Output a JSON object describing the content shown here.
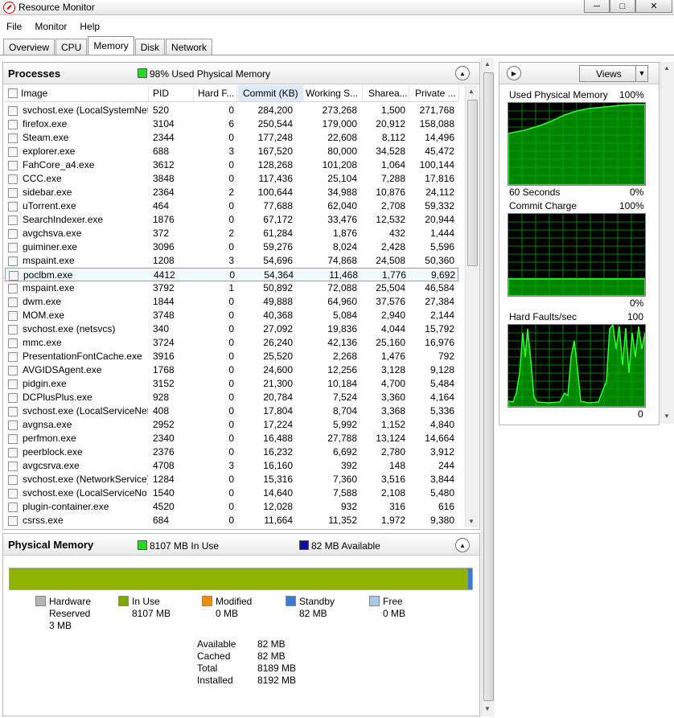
{
  "window": {
    "title": "Resource Monitor"
  },
  "menu": [
    "File",
    "Monitor",
    "Help"
  ],
  "tabs": [
    "Overview",
    "CPU",
    "Memory",
    "Disk",
    "Network"
  ],
  "active_tab": "Memory",
  "processes": {
    "title": "Processes",
    "status": "98% Used Physical Memory",
    "status_color": "#22dd22",
    "columns": [
      "Image",
      "PID",
      "Hard F...",
      "Commit (KB)",
      "Working S...",
      "Sharea...",
      "Private ..."
    ],
    "rows": [
      [
        "svchost.exe (LocalSystemNet...",
        "520",
        "0",
        "284,200",
        "273,268",
        "1,500",
        "271,768"
      ],
      [
        "firefox.exe",
        "3104",
        "6",
        "250,544",
        "179,000",
        "20,912",
        "158,088"
      ],
      [
        "Steam.exe",
        "2344",
        "0",
        "177,248",
        "22,608",
        "8,112",
        "14,496"
      ],
      [
        "explorer.exe",
        "688",
        "3",
        "167,520",
        "80,000",
        "34,528",
        "45,472"
      ],
      [
        "FahCore_a4.exe",
        "3612",
        "0",
        "128,268",
        "101,208",
        "1,064",
        "100,144"
      ],
      [
        "CCC.exe",
        "3848",
        "0",
        "117,436",
        "25,104",
        "7,288",
        "17,816"
      ],
      [
        "sidebar.exe",
        "2364",
        "2",
        "100,644",
        "34,988",
        "10,876",
        "24,112"
      ],
      [
        "uTorrent.exe",
        "464",
        "0",
        "77,688",
        "62,040",
        "2,708",
        "59,332"
      ],
      [
        "SearchIndexer.exe",
        "1876",
        "0",
        "67,172",
        "33,476",
        "12,532",
        "20,944"
      ],
      [
        "avgchsva.exe",
        "372",
        "2",
        "61,284",
        "1,876",
        "432",
        "1,444"
      ],
      [
        "guiminer.exe",
        "3096",
        "0",
        "59,276",
        "8,024",
        "2,428",
        "5,596"
      ],
      [
        "mspaint.exe",
        "1208",
        "3",
        "54,696",
        "74,868",
        "24,508",
        "50,360"
      ],
      [
        "poclbm.exe",
        "4412",
        "0",
        "54,364",
        "11,468",
        "1,776",
        "9,692"
      ],
      [
        "mspaint.exe",
        "3792",
        "1",
        "50,892",
        "72,088",
        "25,504",
        "46,584"
      ],
      [
        "dwm.exe",
        "1844",
        "0",
        "49,888",
        "64,960",
        "37,576",
        "27,384"
      ],
      [
        "MOM.exe",
        "3748",
        "0",
        "40,368",
        "5,084",
        "2,940",
        "2,144"
      ],
      [
        "svchost.exe (netsvcs)",
        "340",
        "0",
        "27,092",
        "19,836",
        "4,044",
        "15,792"
      ],
      [
        "mmc.exe",
        "3724",
        "0",
        "26,240",
        "42,136",
        "25,160",
        "16,976"
      ],
      [
        "PresentationFontCache.exe",
        "3916",
        "0",
        "25,520",
        "2,268",
        "1,476",
        "792"
      ],
      [
        "AVGIDSAgent.exe",
        "1768",
        "0",
        "24,600",
        "12,256",
        "3,128",
        "9,128"
      ],
      [
        "pidgin.exe",
        "3152",
        "0",
        "21,300",
        "10,184",
        "4,700",
        "5,484"
      ],
      [
        "DCPlusPlus.exe",
        "928",
        "0",
        "20,784",
        "7,524",
        "3,360",
        "4,164"
      ],
      [
        "svchost.exe (LocalServiceNet...",
        "408",
        "0",
        "17,804",
        "8,704",
        "3,368",
        "5,336"
      ],
      [
        "avgnsa.exe",
        "2952",
        "0",
        "17,224",
        "5,992",
        "1,152",
        "4,840"
      ],
      [
        "perfmon.exe",
        "2340",
        "0",
        "16,488",
        "27,788",
        "13,124",
        "14,664"
      ],
      [
        "peerblock.exe",
        "2376",
        "0",
        "16,232",
        "6,692",
        "2,780",
        "3,912"
      ],
      [
        "avgcsrva.exe",
        "4708",
        "3",
        "16,160",
        "392",
        "148",
        "244"
      ],
      [
        "svchost.exe (NetworkService)",
        "1284",
        "0",
        "15,316",
        "7,360",
        "3,516",
        "3,844"
      ],
      [
        "svchost.exe (LocalServiceNo...",
        "1540",
        "0",
        "14,640",
        "7,588",
        "2,108",
        "5,480"
      ],
      [
        "plugin-container.exe",
        "4520",
        "0",
        "12,028",
        "932",
        "316",
        "616"
      ],
      [
        "csrss.exe",
        "684",
        "0",
        "11,664",
        "11,352",
        "1,972",
        "9,380"
      ]
    ]
  },
  "physical_memory": {
    "title": "Physical Memory",
    "in_use_label": "8107 MB In Use",
    "available_label": "82 MB Available",
    "in_use_color": "#22dd22",
    "available_color": "#1010a0",
    "usage_fraction": 0.99,
    "legend": [
      {
        "label": "Hardware",
        "label2": "Reserved",
        "value": "3 MB",
        "color": "#b4b4b4"
      },
      {
        "label": "In Use",
        "value": "8107 MB",
        "color": "#7fa800"
      },
      {
        "label": "Modified",
        "value": "0 MB",
        "color": "#f08c00"
      },
      {
        "label": "Standby",
        "value": "82 MB",
        "color": "#3c7bd0"
      },
      {
        "label": "Free",
        "value": "0 MB",
        "color": "#a9c8ec"
      }
    ],
    "stats": [
      {
        "label": "Available",
        "value": "82 MB"
      },
      {
        "label": "Cached",
        "value": "82 MB"
      },
      {
        "label": "Total",
        "value": "8189 MB"
      },
      {
        "label": "Installed",
        "value": "8192 MB"
      }
    ]
  },
  "side": {
    "views_label": "Views",
    "graphs": [
      {
        "title": "Used Physical Memory",
        "max": "100%",
        "footer_left": "60 Seconds",
        "footer_right": "0%"
      },
      {
        "title": "Commit Charge",
        "max": "100%",
        "footer_left": "",
        "footer_right": "0%"
      },
      {
        "title": "Hard Faults/sec",
        "max": "100",
        "footer_left": "",
        "footer_right": "0"
      }
    ]
  }
}
